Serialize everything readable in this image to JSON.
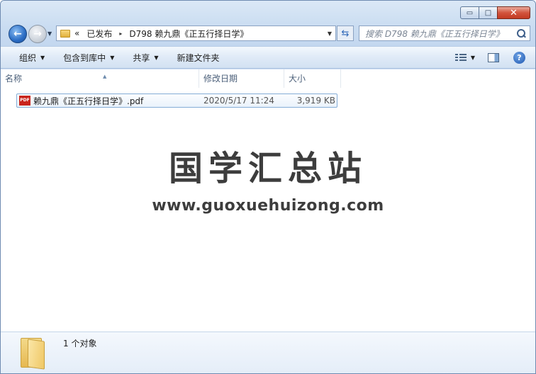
{
  "titlebar": {
    "minimize_glyph": "▭",
    "maximize_glyph": "□",
    "close_glyph": "✕"
  },
  "nav": {
    "back_glyph": "←",
    "forward_glyph": "→"
  },
  "address": {
    "overflow": "«",
    "segments": [
      "已发布",
      "D798 赖九鼎《正五行择日学》"
    ],
    "separator": "▸"
  },
  "search": {
    "placeholder": "搜索 D798 赖九鼎《正五行择日学》"
  },
  "toolbar": {
    "organize_label": "组织",
    "include_label": "包含到库中",
    "share_label": "共享",
    "new_folder_label": "新建文件夹"
  },
  "columns": {
    "name": "名称",
    "date": "修改日期",
    "size": "大小"
  },
  "files": [
    {
      "name": "赖九鼎《正五行择日学》.pdf",
      "modified": "2020/5/17 11:24",
      "size": "3,919 KB",
      "icon": "pdf-icon",
      "icon_text": "PDF"
    }
  ],
  "watermark": {
    "title": "国学汇总站",
    "url": "www.guoxuehuizong.com"
  },
  "details": {
    "count_text": "1 个对象"
  },
  "colors": {
    "frame": "#cfe0f3",
    "selection_border": "#84acd6",
    "pdf_red": "#c8241b",
    "watermark": "#3d3d3d"
  }
}
